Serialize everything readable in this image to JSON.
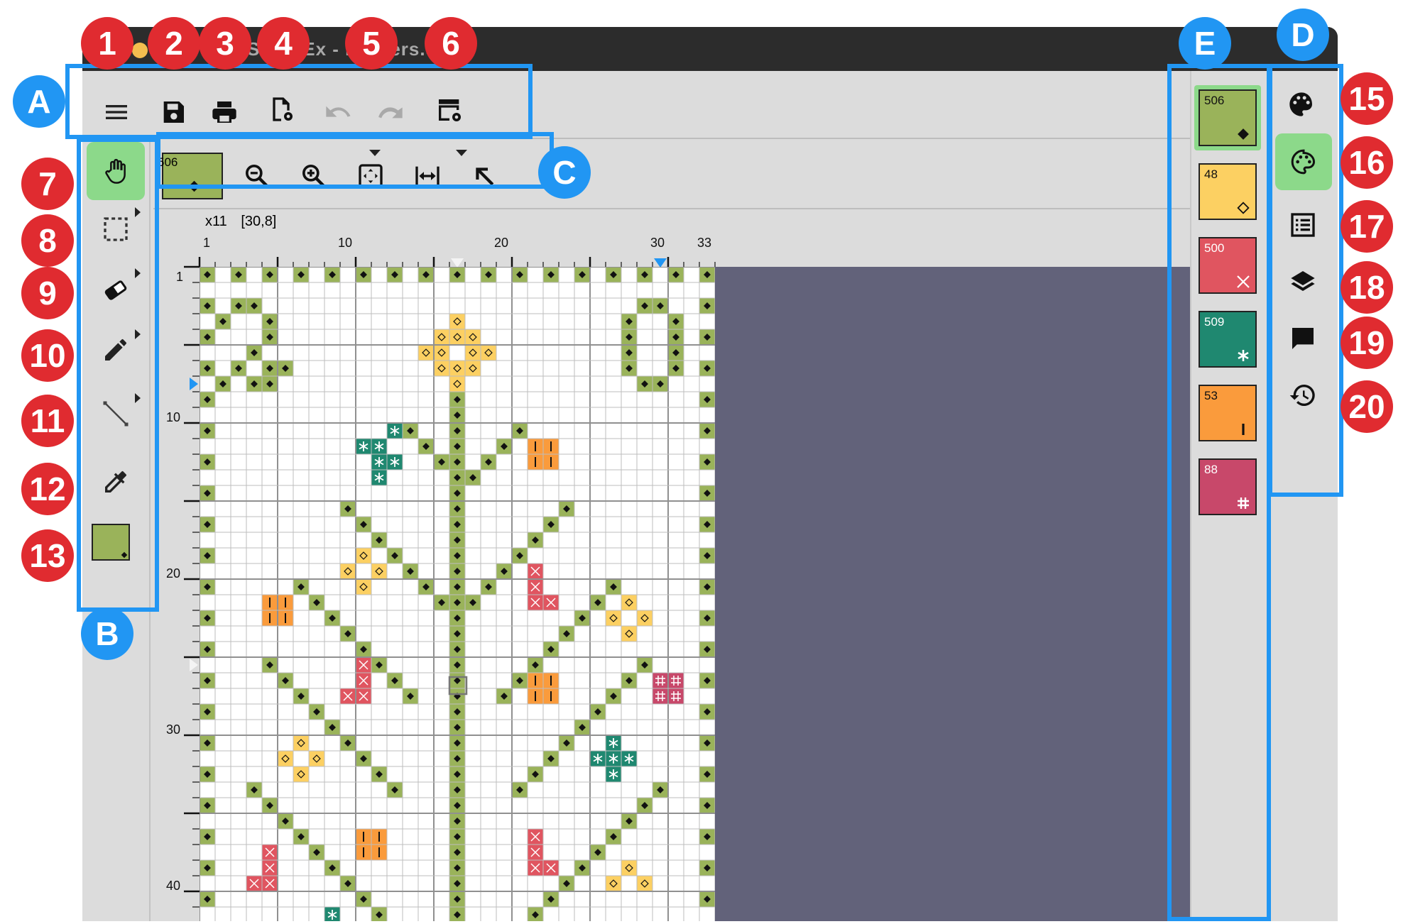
{
  "window": {
    "title": "StitchEx - Flowers.sx"
  },
  "toolbar": {
    "buttons": [
      {
        "name": "menu-icon"
      },
      {
        "name": "save-icon"
      },
      {
        "name": "print-icon"
      },
      {
        "name": "page-settings-icon"
      },
      {
        "name": "undo-icon"
      },
      {
        "name": "redo-icon"
      },
      {
        "name": "export-settings-icon"
      }
    ]
  },
  "tools": [
    {
      "name": "hand-tool",
      "active": true
    },
    {
      "name": "selection-tool"
    },
    {
      "name": "eraser-tool"
    },
    {
      "name": "pencil-tool"
    },
    {
      "name": "line-tool"
    },
    {
      "name": "eyedropper-tool"
    },
    {
      "name": "current-color-tool"
    }
  ],
  "view_toolbar": {
    "current_color_number": "506",
    "buttons": [
      "zoom-out-icon",
      "zoom-in-icon",
      "fit-to-screen-icon",
      "fit-width-icon",
      "pointer-icon"
    ]
  },
  "status": {
    "zoom": "x11",
    "cursor": "[30,8]"
  },
  "ruler": {
    "top_labels": [
      "1",
      "10",
      "20",
      "30",
      "33"
    ],
    "left_labels": [
      "1",
      "10",
      "20",
      "30",
      "40"
    ]
  },
  "palette": [
    {
      "number": "506",
      "color": "#9ab35a",
      "symbol": "diamond-filled",
      "symbol_color": "#111111",
      "selected": true
    },
    {
      "number": "48",
      "color": "#fcd062",
      "symbol": "diamond-outline",
      "symbol_color": "#111111"
    },
    {
      "number": "500",
      "color": "#e05560",
      "symbol": "x-cross",
      "symbol_color": "#ffffff"
    },
    {
      "number": "509",
      "color": "#1f8870",
      "symbol": "asterisk",
      "symbol_color": "#ffffff"
    },
    {
      "number": "53",
      "color": "#fa9b3c",
      "symbol": "bar",
      "symbol_color": "#111111"
    },
    {
      "number": "88",
      "color": "#c8486a",
      "symbol": "hash",
      "symbol_color": "#ffffff"
    }
  ],
  "side_panel": [
    {
      "name": "palette-icon"
    },
    {
      "name": "palette-edit-icon",
      "active": true
    },
    {
      "name": "list-icon"
    },
    {
      "name": "layers-icon"
    },
    {
      "name": "comments-icon"
    },
    {
      "name": "history-icon"
    }
  ],
  "callouts": {
    "red": [
      "1",
      "2",
      "3",
      "4",
      "5",
      "6",
      "7",
      "8",
      "9",
      "10",
      "11",
      "12",
      "13",
      "15",
      "16",
      "17",
      "18",
      "19",
      "20"
    ],
    "blue": [
      "A",
      "B",
      "C",
      "D",
      "E"
    ]
  },
  "colors": {
    "accent_blue": "#2196f3",
    "callout_red": "#e02b30",
    "canvas_bg": "#62627a",
    "active_tool_green": "#8cd98a"
  }
}
